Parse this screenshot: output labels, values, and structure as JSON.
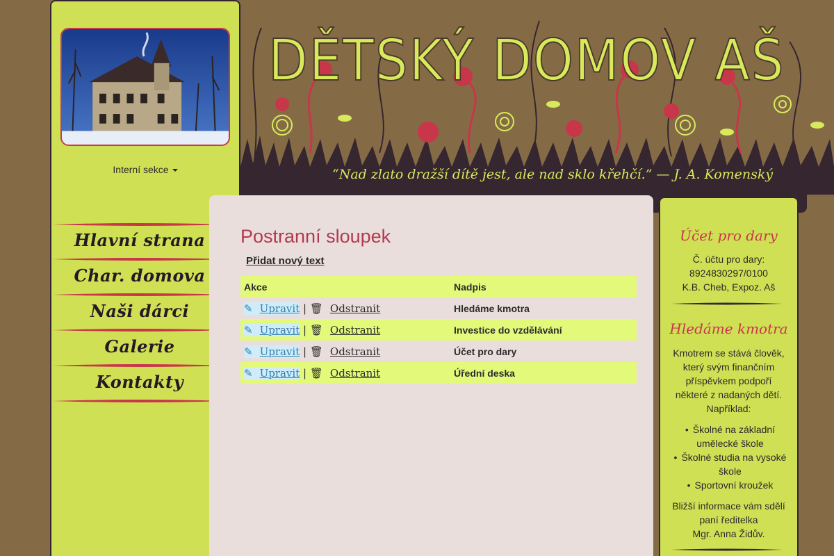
{
  "left": {
    "interni_label": "Interní sekce",
    "nav": [
      {
        "label": "Hlavní strana"
      },
      {
        "label": "Char. domova"
      },
      {
        "label": "Naši dárci"
      },
      {
        "label": "Galerie"
      },
      {
        "label": "Kontakty"
      }
    ]
  },
  "header": {
    "title": "DĚTSKÝ DOMOV AŠ",
    "quote": "“Nad zlato dražší dítě jest, ale nad sklo křehčí.” — J. A. Komenský"
  },
  "main": {
    "heading": "Postranní sloupek",
    "add_link": "Přidat nový text",
    "table": {
      "headers": [
        "Akce",
        "Nadpis"
      ],
      "edit_label": "Upravit",
      "delete_label": "Odstranit",
      "separator": "|",
      "rows": [
        {
          "nadpis": "Hledáme kmotra"
        },
        {
          "nadpis": "Investice do vzdělávání"
        },
        {
          "nadpis": "Účet pro dary"
        },
        {
          "nadpis": "Úřední deska"
        }
      ]
    }
  },
  "right": {
    "box1": {
      "title": "Účet pro dary",
      "line1": "Č. účtu pro dary:",
      "line2": "8924830297/0100",
      "line3": "K.B. Cheb, Expoz. Aš"
    },
    "box2": {
      "title": "Hledáme kmotra",
      "intro": [
        "Kmotrem se stává člověk,",
        "který svým finančním",
        "příspěvkem podpoří",
        "některé z nadaných dětí.",
        "Například:"
      ],
      "items": [
        "Školné na základní umělecké škole",
        "Školné studia na vysoké škole",
        "Sportovní kroužek"
      ],
      "outro": [
        "Bližší informace vám sdělí",
        "paní ředitelka",
        "Mgr. Anna Židův."
      ]
    }
  },
  "icons": {
    "edit": "pencil-icon",
    "delete": "trash-icon",
    "dropdown": "caret-down-icon"
  },
  "colors": {
    "background": "#856b45",
    "sidebar": "#cfe055",
    "accent_red": "#c8364a",
    "header_title": "#d8ea5c",
    "dark": "#35262f",
    "row_highlight": "#e3f97a"
  }
}
